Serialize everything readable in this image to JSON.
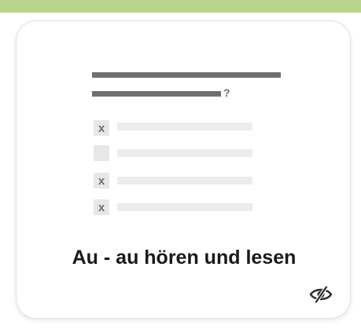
{
  "accent_color": "#b8d48c",
  "tile": {
    "title": "Au - au hören und lesen",
    "status_icon": "eye-slash-icon",
    "illustration": {
      "icon": "multiple-choice-quiz-icon",
      "question_mark": "?",
      "options": [
        {
          "mark": "x"
        },
        {
          "mark": ""
        },
        {
          "mark": "x"
        },
        {
          "mark": "x"
        }
      ]
    }
  }
}
